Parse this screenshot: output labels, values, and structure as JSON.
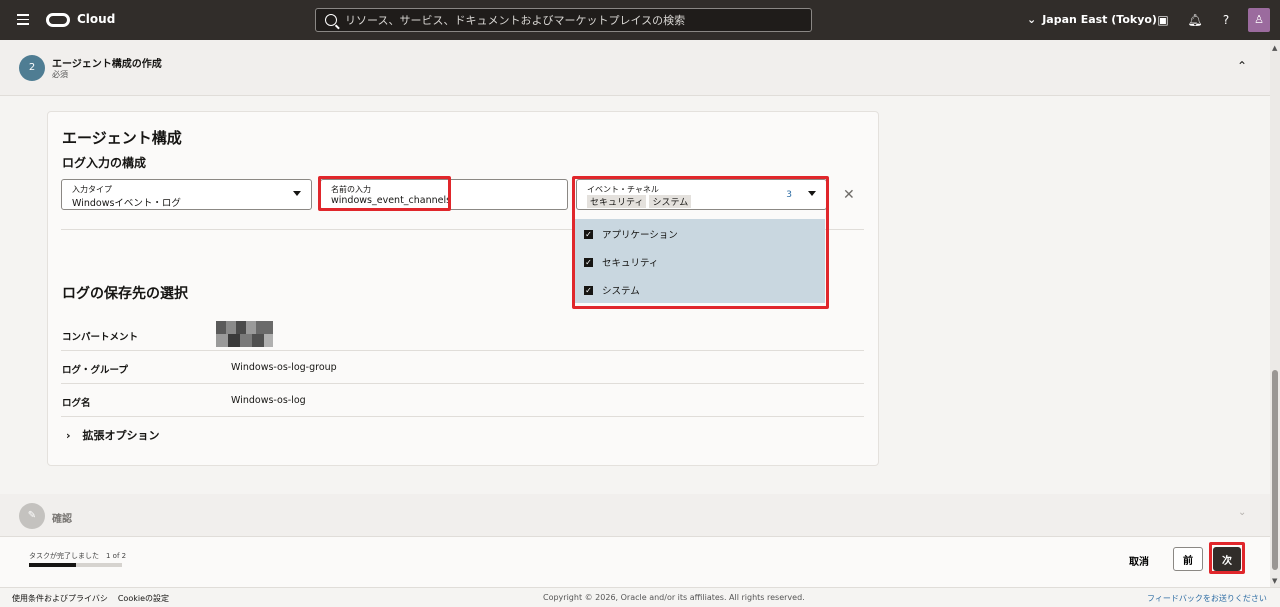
{
  "topbar": {
    "brand": "Cloud",
    "search_placeholder": "リソース、サービス、ドキュメントおよびマーケットプレイスの検索",
    "region": "Japan East (Tokyo)"
  },
  "step2": {
    "number": "2",
    "title": "エージェント構成の作成",
    "subtitle": "必須"
  },
  "card": {
    "title": "エージェント構成",
    "subtitle": "ログ入力の構成",
    "input_type": {
      "label": "入力タイプ",
      "value": "Windowsイベント・ログ"
    },
    "input_name": {
      "label": "名前の入力",
      "value": "windows_event_channels"
    },
    "event_channel": {
      "label": "イベント・チャネル",
      "chips": [
        "セキュリティ",
        "システム"
      ],
      "count": "3",
      "options": [
        "アプリケーション",
        "セキュリティ",
        "システム"
      ]
    },
    "destination_title": "ログの保存先の選択",
    "rows": [
      {
        "label": "コンパートメント",
        "value": ""
      },
      {
        "label": "ログ・グループ",
        "value": "Windows-os-log-group"
      },
      {
        "label": "ログ名",
        "value": "Windows-os-log"
      }
    ],
    "advanced": "拡張オプション"
  },
  "confirm_step": {
    "title": "確認"
  },
  "actionbar": {
    "progress_text": "タスクが完了しました　1 of 2",
    "progress_fraction": 0.5,
    "cancel": "取消",
    "prev": "前",
    "next": "次"
  },
  "footer": {
    "terms": "使用条件およびプライバシ",
    "cookie": "Cookieの設定",
    "copyright": "Copyright © 2026, Oracle and/or its affiliates. All rights reserved.",
    "feedback": "フィードバックをお送りください"
  }
}
